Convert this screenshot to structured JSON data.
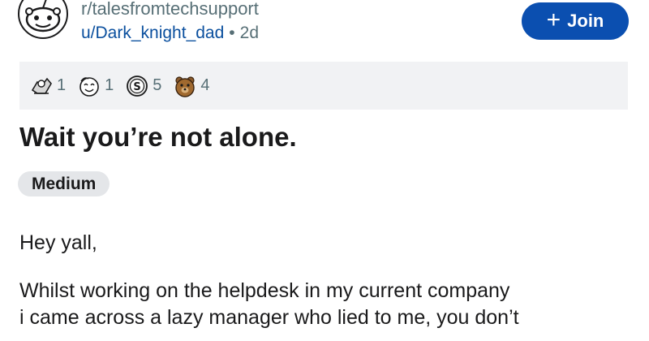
{
  "header": {
    "subreddit": "r/talesfromtechsupport",
    "username": "u/Dark_knight_dad",
    "separator": "•",
    "age": "2d",
    "join_label": "Join",
    "join_icon": "plus-icon"
  },
  "awards": [
    {
      "icon": "helpful-award-icon",
      "count": "1"
    },
    {
      "icon": "wholesome-award-icon",
      "count": "1"
    },
    {
      "icon": "silver-award-icon",
      "count": "5"
    },
    {
      "icon": "bear-award-icon",
      "count": "4"
    }
  ],
  "post": {
    "title": "Wait you’re not alone.",
    "flair": "Medium",
    "greeting": "Hey yall,",
    "body_lines": [
      "Whilst working on the helpdesk in my current company",
      "i came across a lazy manager who lied to me, you don’t"
    ]
  },
  "colors": {
    "join_button": "#0b4fb0",
    "username": "#0a4f9e",
    "muted": "#576f76",
    "awards_bar": "#f1f2f4",
    "flair_bg": "#e4e6e9"
  }
}
